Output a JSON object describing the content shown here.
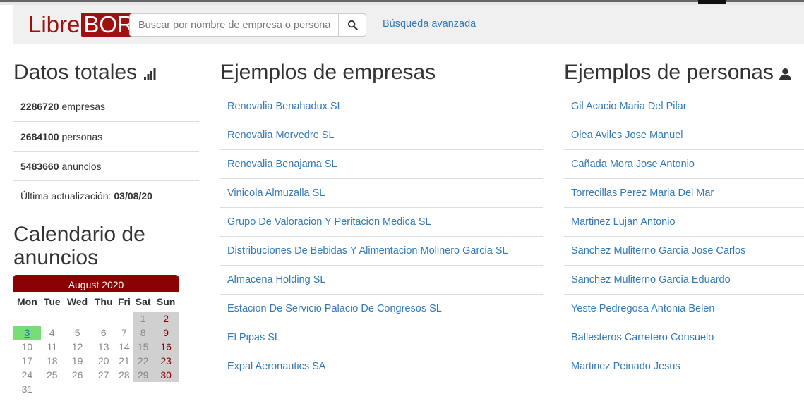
{
  "brand": {
    "part1": "Libre",
    "part2": "BOR"
  },
  "search": {
    "placeholder": "Buscar por nombre de empresa o persona"
  },
  "nav": {
    "advanced_search": "Búsqueda avanzada"
  },
  "totals": {
    "title": "Datos totales",
    "rows": [
      {
        "value": "2286720",
        "label": "empresas"
      },
      {
        "value": "2684100",
        "label": "personas"
      },
      {
        "value": "5483660",
        "label": "anuncios"
      }
    ],
    "updated_label": "Última actualización:",
    "updated_value": "03/08/20"
  },
  "calendar": {
    "title": "Calendario de anuncios",
    "month": "August 2020",
    "weekdays": [
      "Mon",
      "Tue",
      "Wed",
      "Thu",
      "Fri",
      "Sat",
      "Sun"
    ],
    "weeks": [
      [
        "",
        "",
        "",
        "",
        "",
        "1",
        "2"
      ],
      [
        "3",
        "4",
        "5",
        "6",
        "7",
        "8",
        "9"
      ],
      [
        "10",
        "11",
        "12",
        "13",
        "14",
        "15",
        "16"
      ],
      [
        "17",
        "18",
        "19",
        "20",
        "21",
        "22",
        "23"
      ],
      [
        "24",
        "25",
        "26",
        "27",
        "28",
        "29",
        "30"
      ],
      [
        "31",
        "",
        "",
        "",
        "",
        "",
        ""
      ]
    ],
    "today": "3"
  },
  "companies": {
    "title": "Ejemplos de empresas",
    "items": [
      "Renovalia Benahadux SL",
      "Renovalia Morvedre SL",
      "Renovalia Benajama SL",
      "Vinicola Almuzalla SL",
      "Grupo De Valoracion Y Peritacion Medica SL",
      "Distribuciones De Bebidas Y Alimentacion Molinero Garcia SL",
      "Almacena Holding SL",
      "Estacion De Servicio Palacio De Congresos SL",
      "El Pipas SL",
      "Expal Aeronautics SA"
    ]
  },
  "people": {
    "title": "Ejemplos de personas",
    "items": [
      "Gil Acacio Maria Del Pilar",
      "Olea Aviles Jose Manuel",
      "Cañada Mora Jose Antonio",
      "Torrecillas Perez Maria Del Mar",
      "Martinez Lujan Antonio",
      "Sanchez Muliterno Garcia Jose Carlos",
      "Sanchez Muliterno Garcia Eduardo",
      "Yeste Pedregosa Antonia Belen",
      "Ballesteros Carretero Consuelo",
      "Martinez Peinado Jesus"
    ]
  },
  "colors": {
    "brand": "#a01010",
    "link": "#337ab7",
    "calendar_header": "#8b0000",
    "today": "#77dd77"
  },
  "icons": {
    "search": "search-icon",
    "stats": "bar-chart-icon",
    "person": "user-icon"
  }
}
